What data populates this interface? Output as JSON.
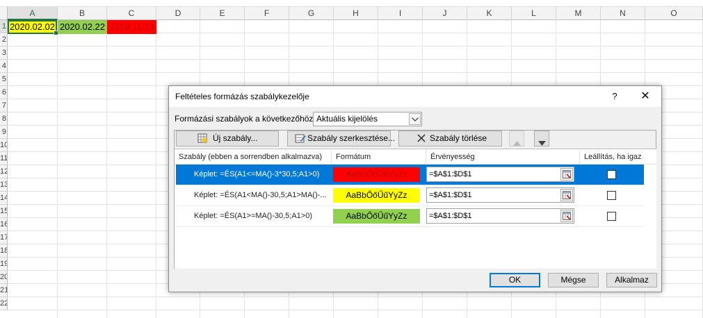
{
  "sheet": {
    "columns": [
      "A",
      "B",
      "C",
      "D",
      "E",
      "F",
      "G",
      "H",
      "I",
      "J",
      "K",
      "L",
      "M",
      "N",
      "O"
    ],
    "rows": [
      "1",
      "2",
      "3",
      "4",
      "5",
      "6",
      "7",
      "8",
      "9",
      "10",
      "11",
      "12",
      "13",
      "14",
      "15",
      "16",
      "17",
      "18",
      "19",
      "20",
      "21",
      "22"
    ],
    "cells": {
      "A1": {
        "value": "2020.02.02",
        "fill": "#ffff00",
        "color": "#000000"
      },
      "B1": {
        "value": "2020.02.22",
        "fill": "#92d050",
        "color": "#000000"
      },
      "C1": {
        "value": "2019.11.13",
        "fill": "#ff0000",
        "color": "#c00000"
      }
    },
    "selected_cell": "A1"
  },
  "dialog": {
    "title": "Feltételes formázás szabálykezelője",
    "help": "?",
    "close": "✕",
    "show_label": "Formázási szabályok a következőhöz:",
    "scope_value": "Aktuális kijelölés",
    "toolbar": {
      "new_rule": "Új szabály...",
      "edit_rule": "Szabály szerkesztése...",
      "delete_rule": "Szabály törlése"
    },
    "columns": {
      "rule": "Szabály (ebben a sorrendben alkalmazva)",
      "format": "Formátum",
      "applies_to": "Érvényesség",
      "stop_if_true": "Leállítás, ha igaz"
    },
    "rules": [
      {
        "formula": "Képlet: =ÉS(A1<=MA()-3*30,5;A1>0)",
        "preview": "AaBbŐőŰűYyZz",
        "fill": "#ff0000",
        "text_color": "#c00000",
        "applies_to": "=$A$1:$D$1",
        "stop": false,
        "selected": true
      },
      {
        "formula": "Képlet: =ÉS(A1<MA()-30,5;A1>MA()-...",
        "preview": "AaBbŐőŰűYyZz",
        "fill": "#ffff00",
        "text_color": "#000000",
        "applies_to": "=$A$1:$D$1",
        "stop": false,
        "selected": false
      },
      {
        "formula": "Képlet: =ÉS(A1>=MA()-30,5;A1>0)",
        "preview": "AaBbŐőŰűYyZz",
        "fill": "#92d050",
        "text_color": "#000000",
        "applies_to": "=$A$1:$D$1",
        "stop": false,
        "selected": false
      }
    ],
    "buttons": {
      "ok": "OK",
      "cancel": "Mégse",
      "apply": "Alkalmaz"
    },
    "colors": {
      "selection": "#0078d7",
      "excel_green": "#217346"
    }
  }
}
